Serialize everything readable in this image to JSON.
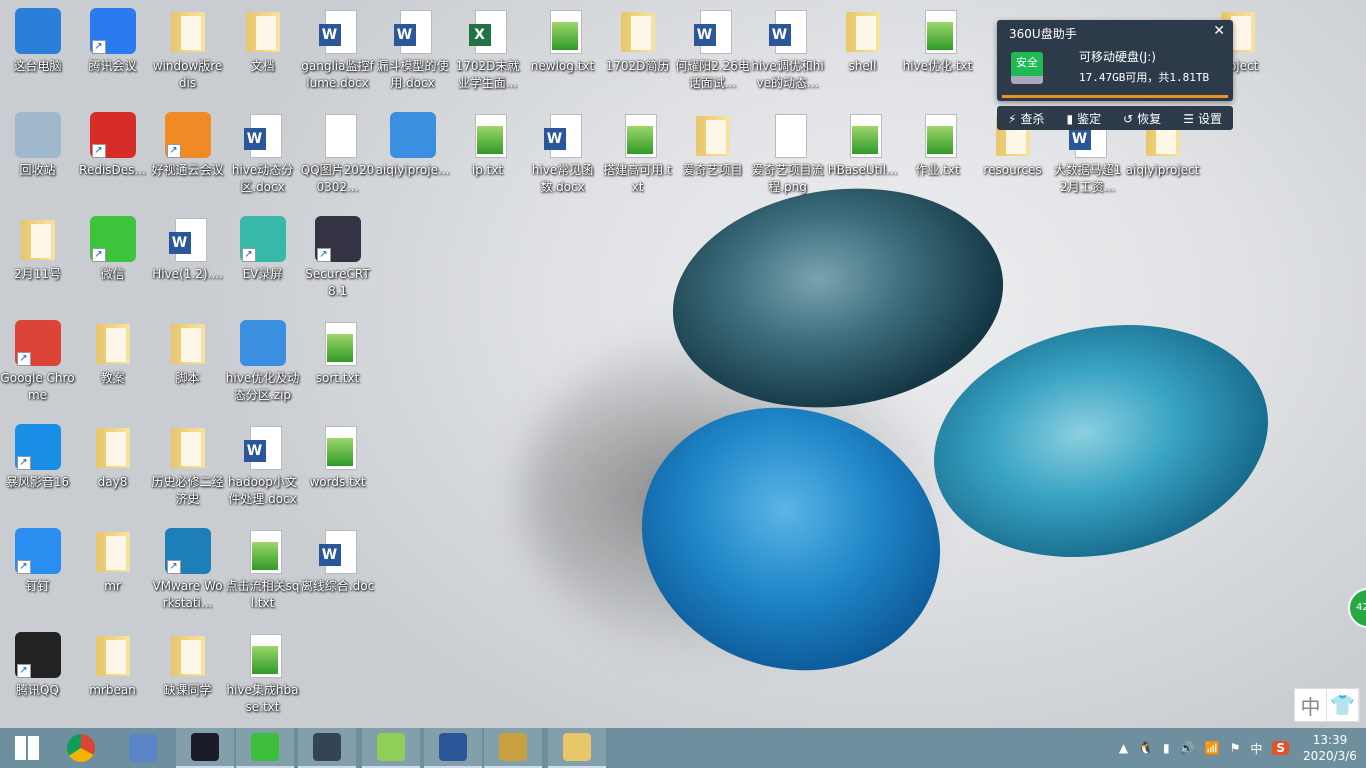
{
  "desktop": {
    "icons": [
      {
        "label": "这台电脑",
        "type": "app",
        "color": "#2a7fd8",
        "col": 0,
        "row": 0
      },
      {
        "label": "腾讯会议",
        "type": "app",
        "color": "#2b7bf0",
        "col": 1,
        "row": 0,
        "shortcut": true
      },
      {
        "label": "window版redis",
        "type": "folder",
        "col": 2,
        "row": 0
      },
      {
        "label": "文档",
        "type": "folder",
        "col": 3,
        "row": 0
      },
      {
        "label": "ganglia监控flume.docx",
        "type": "word",
        "col": 4,
        "row": 0
      },
      {
        "label": "漏斗模型的使用.docx",
        "type": "word",
        "col": 5,
        "row": 0
      },
      {
        "label": "1702D末就业学生面...",
        "type": "excel",
        "col": 6,
        "row": 0
      },
      {
        "label": "newlog.txt",
        "type": "txt",
        "col": 7,
        "row": 0
      },
      {
        "label": "1702D简历",
        "type": "folder",
        "col": 8,
        "row": 0
      },
      {
        "label": "何耀阳2.26电话面试...",
        "type": "word",
        "col": 9,
        "row": 0
      },
      {
        "label": "hive调优和hive的动态...",
        "type": "word",
        "col": 10,
        "row": 0
      },
      {
        "label": "shell",
        "type": "folder",
        "col": 11,
        "row": 0
      },
      {
        "label": "hive优化.txt",
        "type": "txt",
        "col": 12,
        "row": 0
      },
      {
        "label": "project",
        "type": "folder",
        "col": 16,
        "row": 0
      },
      {
        "label": "回收站",
        "type": "app",
        "color": "#9fb8cc",
        "col": 0,
        "row": 1
      },
      {
        "label": "RedisDes...",
        "type": "app",
        "color": "#d62d28",
        "col": 1,
        "row": 1,
        "shortcut": true
      },
      {
        "label": "好视通云会议",
        "type": "app",
        "color": "#f08a24",
        "col": 2,
        "row": 1,
        "shortcut": true
      },
      {
        "label": "hive动态分区.docx",
        "type": "word",
        "col": 3,
        "row": 1
      },
      {
        "label": "QQ图片20200302...",
        "type": "png",
        "col": 4,
        "row": 1
      },
      {
        "label": "aiqiyiproje...",
        "type": "app",
        "color": "#3a8fe0",
        "col": 5,
        "row": 1
      },
      {
        "label": "ip.txt",
        "type": "txt",
        "col": 6,
        "row": 1
      },
      {
        "label": "hive常见函数.docx",
        "type": "word",
        "col": 7,
        "row": 1
      },
      {
        "label": "搭建高可用.txt",
        "type": "txt",
        "col": 8,
        "row": 1
      },
      {
        "label": "爱奇艺项目",
        "type": "folder",
        "col": 9,
        "row": 1
      },
      {
        "label": "爱奇艺项目流程.png",
        "type": "png",
        "col": 10,
        "row": 1
      },
      {
        "label": "HBaseUtil...",
        "type": "txt",
        "col": 11,
        "row": 1
      },
      {
        "label": "作业.txt",
        "type": "txt",
        "col": 12,
        "row": 1
      },
      {
        "label": "resources",
        "type": "folder",
        "col": 13,
        "row": 1
      },
      {
        "label": "大数据马超12月工资...",
        "type": "word",
        "col": 14,
        "row": 1
      },
      {
        "label": "aiqiyiproject",
        "type": "folder",
        "col": 15,
        "row": 1
      },
      {
        "label": "2月11号",
        "type": "folder",
        "col": 0,
        "row": 2
      },
      {
        "label": "微信",
        "type": "app",
        "color": "#3ec43a",
        "col": 1,
        "row": 2,
        "shortcut": true
      },
      {
        "label": "Hive(1.2)....",
        "type": "word",
        "col": 2,
        "row": 2
      },
      {
        "label": "EV录屏",
        "type": "app",
        "color": "#38b8a8",
        "col": 3,
        "row": 2,
        "shortcut": true
      },
      {
        "label": "SecureCRT 8.1",
        "type": "app",
        "color": "#334",
        "col": 4,
        "row": 2,
        "shortcut": true
      },
      {
        "label": "Google Chrome",
        "type": "app",
        "color": "#db4437",
        "col": 0,
        "row": 3,
        "shortcut": true
      },
      {
        "label": "教案",
        "type": "folder",
        "col": 1,
        "row": 3
      },
      {
        "label": "脚本",
        "type": "folder",
        "col": 2,
        "row": 3
      },
      {
        "label": "hive优化及动态分区.zip",
        "type": "app",
        "color": "#3a8fe0",
        "col": 3,
        "row": 3
      },
      {
        "label": "sort.txt",
        "type": "txt",
        "col": 4,
        "row": 3
      },
      {
        "label": "暴风影音16",
        "type": "app",
        "color": "#1a8fe8",
        "col": 0,
        "row": 4,
        "shortcut": true
      },
      {
        "label": "day8",
        "type": "folder",
        "col": 1,
        "row": 4
      },
      {
        "label": "历史必修二经济史",
        "type": "folder",
        "col": 2,
        "row": 4
      },
      {
        "label": "hadoop小文件处理.docx",
        "type": "word",
        "col": 3,
        "row": 4
      },
      {
        "label": "words.txt",
        "type": "txt",
        "col": 4,
        "row": 4
      },
      {
        "label": "钉钉",
        "type": "app",
        "color": "#2a8ef0",
        "col": 0,
        "row": 5,
        "shortcut": true
      },
      {
        "label": "mr",
        "type": "folder",
        "col": 1,
        "row": 5
      },
      {
        "label": "VMware Workstati...",
        "type": "app",
        "color": "#1e7fb8",
        "col": 2,
        "row": 5,
        "shortcut": true
      },
      {
        "label": "点击流相关sql.txt",
        "type": "txt",
        "col": 3,
        "row": 5
      },
      {
        "label": "离线综合.doc",
        "type": "word",
        "col": 4,
        "row": 5
      },
      {
        "label": "腾讯QQ",
        "type": "app",
        "color": "#222",
        "col": 0,
        "row": 6,
        "shortcut": true
      },
      {
        "label": "mrbean",
        "type": "folder",
        "col": 1,
        "row": 6
      },
      {
        "label": "缺课同学",
        "type": "folder",
        "col": 2,
        "row": 6
      },
      {
        "label": "hive集成hbase.txt",
        "type": "txt",
        "col": 3,
        "row": 6
      }
    ]
  },
  "popup": {
    "title": "360U盘助手",
    "close": "✕",
    "badge": "安全",
    "drive_name": "可移动硬盘(J:)",
    "space": "17.47GB可用，共1.81TB",
    "tools": [
      {
        "icon": "lightning-icon",
        "glyph": "⚡",
        "label": "查杀"
      },
      {
        "icon": "usb-icon",
        "glyph": "▮",
        "label": "鉴定"
      },
      {
        "icon": "restore-icon",
        "glyph": "↺",
        "label": "恢复"
      },
      {
        "icon": "settings-icon",
        "glyph": "☰",
        "label": "设置"
      }
    ]
  },
  "ime_bar": {
    "lang": "中",
    "skin": "👕"
  },
  "side_widget": "42",
  "taskbar": {
    "items": [
      {
        "name": "start",
        "color": "#ffffff",
        "open": false
      },
      {
        "name": "chrome",
        "color": "#db4437",
        "open": false
      },
      {
        "name": "dolphin",
        "color": "#5a86c8",
        "open": false
      },
      {
        "name": "intellij",
        "color": "#1b1b2a",
        "open": true
      },
      {
        "name": "360-browser",
        "color": "#3cbf3c",
        "open": true
      },
      {
        "name": "securecrt",
        "color": "#334455",
        "open": true
      },
      {
        "name": "notepad-plus-plus",
        "color": "#8fcf58",
        "open": true
      },
      {
        "name": "word",
        "color": "#2b579a",
        "open": true
      },
      {
        "name": "image-viewer",
        "color": "#c8a040",
        "open": true
      },
      {
        "name": "file-explorer",
        "color": "#e8c66a",
        "open": true
      }
    ],
    "tray": {
      "chevron": "▲",
      "qq": "🐧",
      "battery": "▮",
      "volume": "🔊",
      "signal": "📶",
      "flag": "⚑",
      "ime": "中",
      "sogou": "S"
    },
    "time": "13:39",
    "date": "2020/3/6"
  }
}
